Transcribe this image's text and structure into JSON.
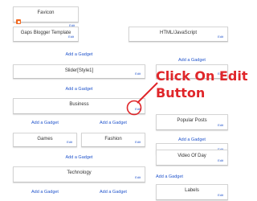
{
  "gadgets": {
    "favicon": {
      "title": "Favicon",
      "edit": "Edit"
    },
    "template": {
      "title": "Gaps Blogger Template",
      "edit": "Edit"
    },
    "html_js": {
      "title": "HTML/JavaScript",
      "edit": "Edit"
    },
    "slider": {
      "title": "Slider[Style1]",
      "edit": "Edit"
    },
    "business": {
      "title": "Business",
      "edit": "Edit"
    },
    "games": {
      "title": "Games",
      "edit": "Edit"
    },
    "fashion": {
      "title": "Fashion",
      "edit": "Edit"
    },
    "technology": {
      "title": "Technology",
      "edit": "Edit"
    },
    "popular_posts": {
      "title": "Popular Posts",
      "edit": "Edit"
    },
    "video_of_day": {
      "title": "Video Of Day",
      "edit": "Edit"
    },
    "labels": {
      "title": "Labels",
      "edit": "Edit"
    }
  },
  "add_gadget": "Add a Gadget",
  "callout": {
    "line1": "Click On Edit",
    "line2": "Button",
    "color": "#e0262a"
  },
  "colors": {
    "link": "#2255cc",
    "border": "#d4d4d4",
    "accent": "#e0262a"
  }
}
